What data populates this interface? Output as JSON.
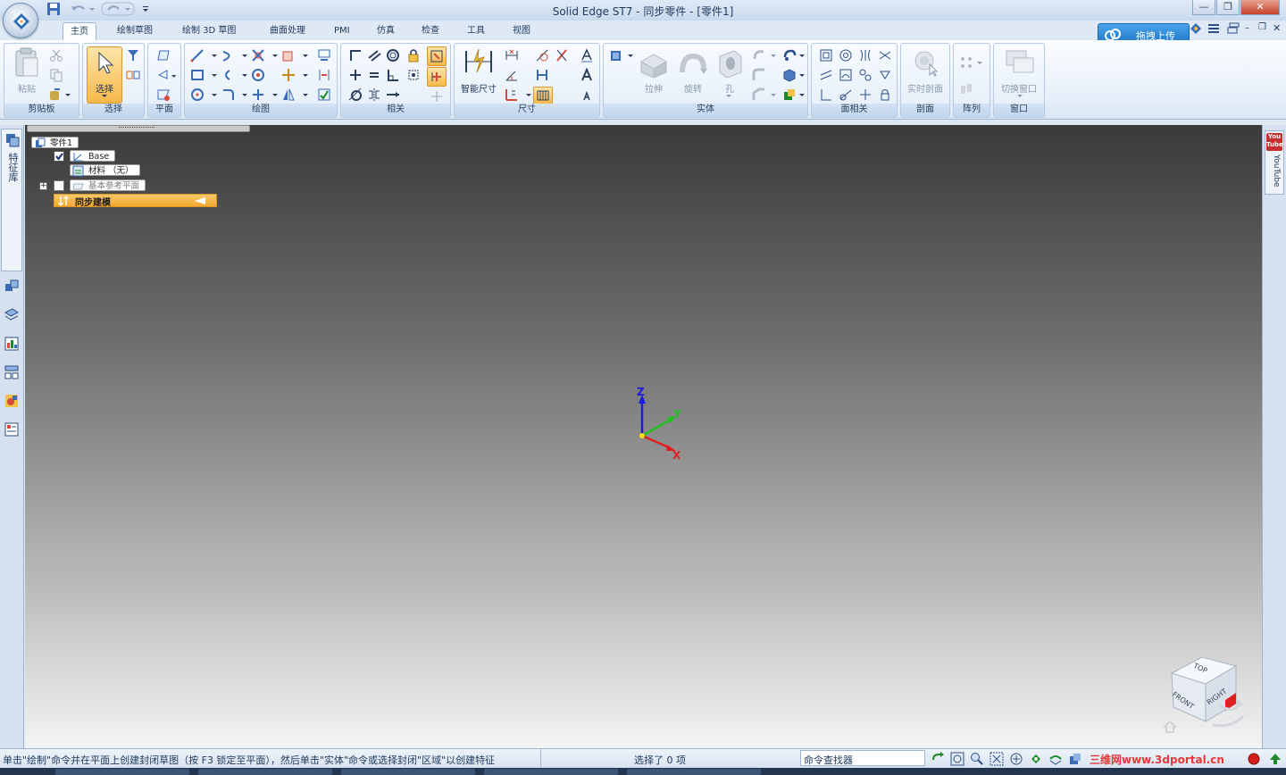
{
  "titlebar": {
    "title": "Solid Edge ST7 - 同步零件 - [零件1]"
  },
  "window_controls": {
    "minimize": "—",
    "maximize": "❐",
    "close": "✕"
  },
  "tabs": [
    "主页",
    "绘制草图",
    "绘制 3D 草图",
    "曲面处理",
    "PMI",
    "仿真",
    "检查",
    "工具",
    "视图"
  ],
  "upload": {
    "label": "拖拽上传"
  },
  "ribbon": {
    "paste_label": "粘贴",
    "select_label": "选择",
    "smart_dim_label": "智能尺寸",
    "extrude_label": "拉伸",
    "revolve_label": "旋转",
    "hole_label": "孔",
    "live_section_label": "实时剖面",
    "switch_window_label": "切换窗口",
    "groups": {
      "clipboard": "剪贴板",
      "select": "选择",
      "plane": "平面",
      "draw": "绘图",
      "relate": "相关",
      "dimension": "尺寸",
      "solid": "实体",
      "face_relate": "面相关",
      "section": "剖面",
      "pattern": "阵列",
      "window": "窗口"
    }
  },
  "left_panel": {
    "feature_library": "特征库"
  },
  "right_panel": {
    "youtube_badge": "You Tube",
    "youtube_label": "YouTube"
  },
  "tree": {
    "root": "零件1",
    "base": "Base",
    "material": "材料 （无）",
    "ref_planes": "基本参考平面",
    "sync": "同步建模"
  },
  "triad": {
    "z": "Z",
    "y": "Y",
    "x": "X"
  },
  "view_cube": {
    "top": "TOP",
    "front": "FRONT",
    "right": "RIGHT"
  },
  "status": {
    "prompt": "单击\"绘制\"命令并在平面上创建封闭草图（按 F3 锁定至平面），然后单击\"实体\"命令或选择封闭\"区域\"以创建特征",
    "selection": "选择了 0 项",
    "command_finder": "命令查找器",
    "watermark": "三维网www.3dportal.cn"
  },
  "colors": {
    "accent": "#f6b94a",
    "ribbon_bg": "#e8f0fa",
    "x_axis": "#e02020",
    "y_axis": "#20c020",
    "z_axis": "#1c1ce0"
  }
}
